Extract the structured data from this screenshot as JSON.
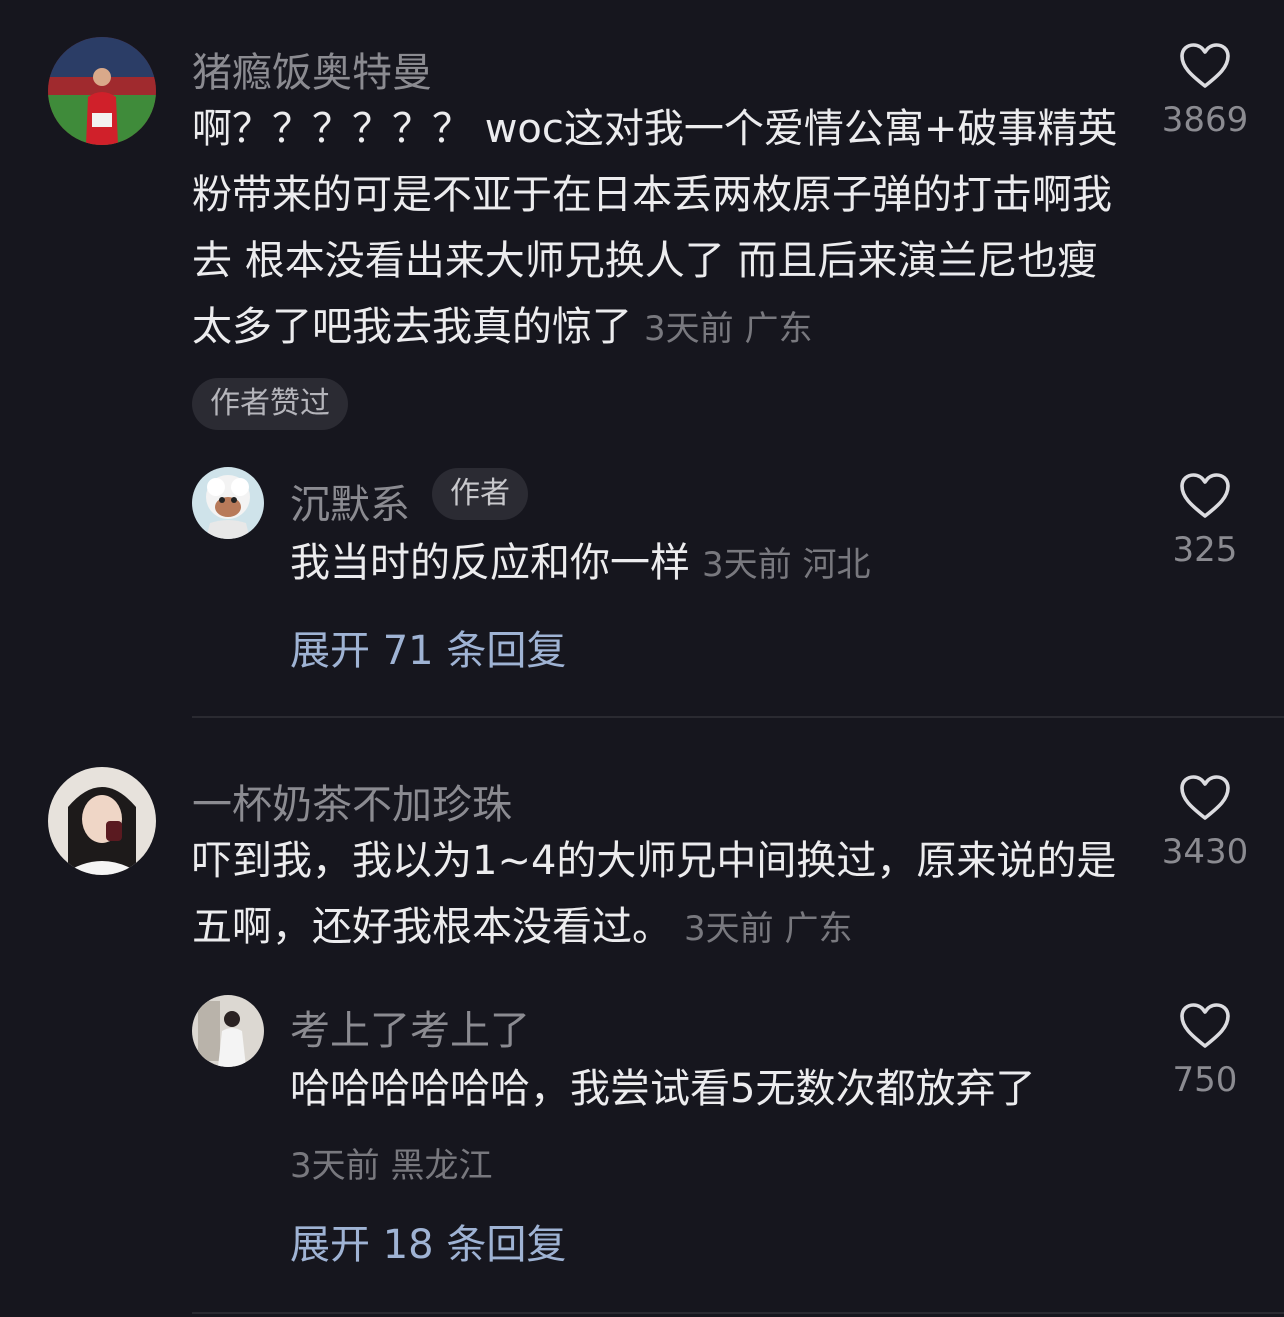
{
  "comments": [
    {
      "user": "猪瘾饭奥特曼",
      "text": "啊？？？？？？ woc这对我一个爱情公寓+破事精英粉带来的可是不亚于在日本丢两枚原子弹的打击啊我去 根本没看出来大师兄换人了 而且后来演兰尼也瘦太多了吧我去我真的惊了",
      "meta": "3天前 广东",
      "likes": "3869",
      "badge": "作者赞过",
      "reply": {
        "user": "沉默系",
        "author_tag": "作者",
        "text": "我当时的反应和你一样",
        "meta": "3天前 河北",
        "likes": "325",
        "expand": "展开 71 条回复"
      }
    },
    {
      "user": "一杯奶茶不加珍珠",
      "text": "吓到我，我以为1~4的大师兄中间换过，原来说的是五啊，还好我根本没看过。",
      "meta": "3天前 广东",
      "likes": "3430",
      "reply": {
        "user": "考上了考上了",
        "text": "哈哈哈哈哈哈，我尝试看5无数次都放弃了",
        "meta": "3天前 黑龙江",
        "likes": "750",
        "expand": "展开 18 条回复"
      }
    }
  ]
}
